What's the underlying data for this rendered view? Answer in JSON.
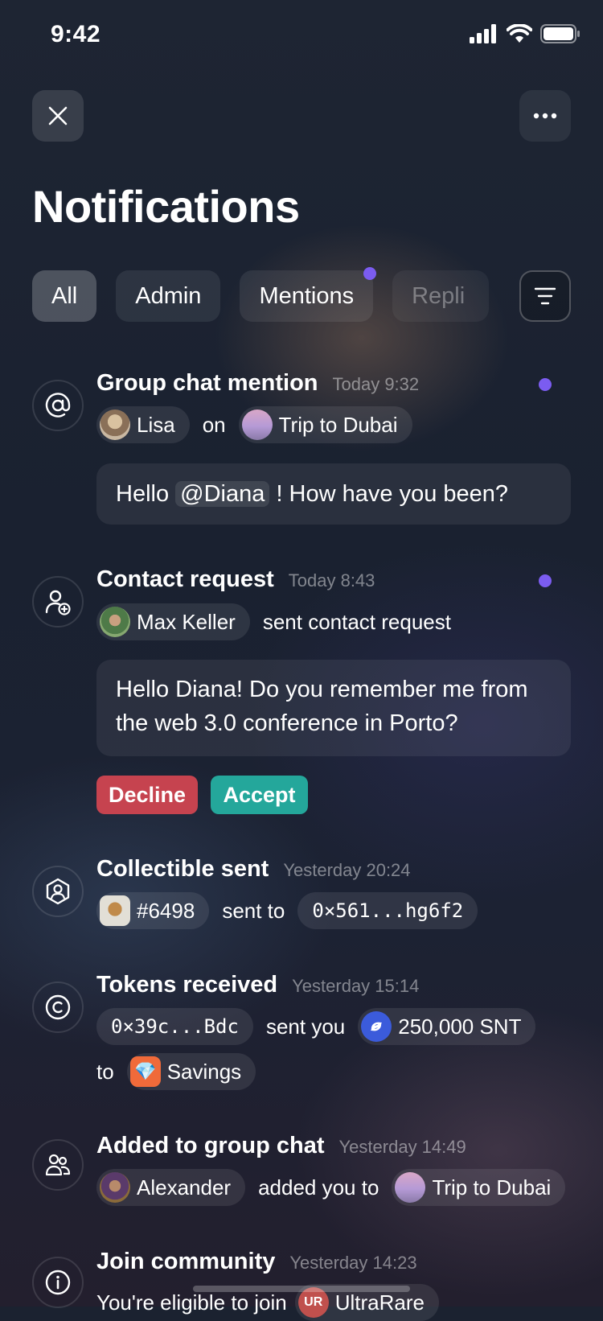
{
  "status_bar": {
    "time": "9:42"
  },
  "header": {
    "title": "Notifications"
  },
  "tabs": [
    {
      "label": "All",
      "active": true
    },
    {
      "label": "Admin",
      "active": false
    },
    {
      "label": "Mentions",
      "active": false,
      "unread_dot": true
    },
    {
      "label": "Repli",
      "active": false
    }
  ],
  "notifications": {
    "mention": {
      "title": "Group chat mention",
      "time": "Today 9:32",
      "unread": true,
      "user": "Lisa",
      "connector": "on",
      "chat": "Trip to Dubai",
      "msg_before": "Hello",
      "mention": "@Diana",
      "msg_after": "! How have you been?"
    },
    "contact": {
      "title": "Contact request",
      "time": "Today 8:43",
      "unread": true,
      "user": "Max Keller",
      "action": "sent contact request",
      "message": "Hello Diana! Do you remember me from the web 3.0 conference in Porto?",
      "decline_label": "Decline",
      "accept_label": "Accept"
    },
    "collectible": {
      "title": "Collectible sent",
      "time": "Yesterday 20:24",
      "item": "#6498",
      "connector": "sent to",
      "address": "0×561...hg6f2"
    },
    "tokens": {
      "title": "Tokens received",
      "time": "Yesterday 15:14",
      "address": "0×39c...Bdc",
      "connector": "sent you",
      "amount": "250,000 SNT",
      "to_word": "to",
      "account": "Savings"
    },
    "group": {
      "title": "Added to group chat",
      "time": "Yesterday 14:49",
      "user": "Alexander",
      "connector": "added you to",
      "chat": "Trip to Dubai"
    },
    "community": {
      "title": "Join community",
      "time": "Yesterday 14:23",
      "text": "You're eligible to join",
      "community": "UltraRare",
      "community_badge": "UR"
    }
  },
  "colors": {
    "unread_dot": "#7b5cf0",
    "decline": "#c6434f",
    "accept": "#24a79b",
    "snt": "#3b5bdb",
    "savings": "#f06a3a"
  }
}
